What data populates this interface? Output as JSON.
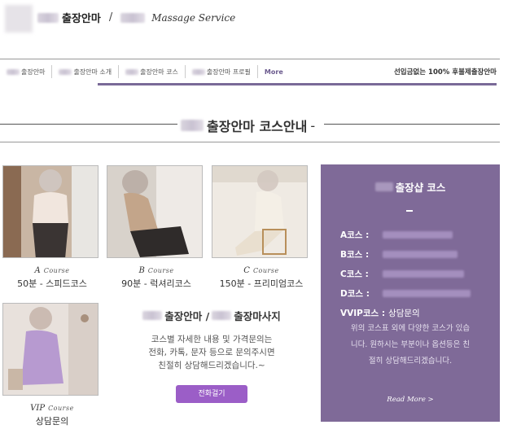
{
  "header": {
    "brand_ko": "출장안마",
    "brand_slash": "/",
    "brand_en": "Massage Service"
  },
  "nav": {
    "items": [
      {
        "label": "출장안마"
      },
      {
        "label": "출장안마 소개"
      },
      {
        "label": "출장안마 코스"
      },
      {
        "label": "출장안마 프로필"
      }
    ],
    "more": "More",
    "right_text": "선입금없는 100% 후불제출장안마"
  },
  "section": {
    "title": "출장안마 코스안내",
    "dash": "-"
  },
  "courses": [
    {
      "letter": "A",
      "word": "Course",
      "desc": "50분 - 스피드코스"
    },
    {
      "letter": "B",
      "word": "Course",
      "desc": "90분 - 럭셔리코스"
    },
    {
      "letter": "C",
      "word": "Course",
      "desc": "150분 - 프리미엄코스"
    },
    {
      "letter": "VIP",
      "word": "Course",
      "desc": "상담문의"
    }
  ],
  "info": {
    "title_part1": "출장안마 /",
    "title_part2": "출장마사지",
    "line1": "코스별 자세한 내용 및 가격문의는",
    "line2": "전화, 카톡, 문자 등으로 문의주시면",
    "line3": "친절히 상담해드리겠습니다.~",
    "button": "전화걸기"
  },
  "panel": {
    "title": "출장샵 코스",
    "dash": "-",
    "rows": [
      {
        "label": "A코스 :"
      },
      {
        "label": "B코스 :"
      },
      {
        "label": "C코스 :"
      },
      {
        "label": "D코스 :"
      },
      {
        "label": "VVIP코스 :",
        "value": "상담문의"
      }
    ],
    "desc_line1": "위의 코스표 외에 다양한 코스가 있습",
    "desc_line2": "니다. 원하시는 부분이나 옵션등은 친",
    "desc_line3": "절히 상담해드리겠습니다.",
    "read_more": "Read More >"
  }
}
